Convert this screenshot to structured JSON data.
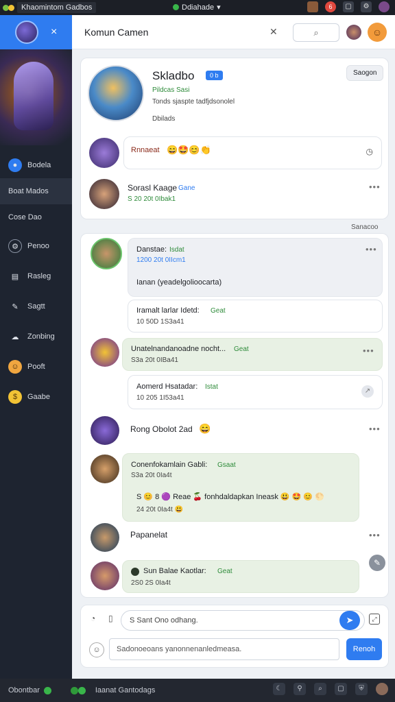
{
  "topbar": {
    "app_title": "Khaomintom Gadbos",
    "center_label": "Ddiahade",
    "badge_count": "6"
  },
  "sidebar": {
    "close_icon": "×",
    "items": [
      {
        "label": "Bodela",
        "icon": "user-circle"
      },
      {
        "label": "Boat Mados",
        "icon": ""
      },
      {
        "label": "Cose Dao",
        "icon": ""
      },
      {
        "label": "Penoo",
        "icon": "settings"
      },
      {
        "label": "Rasleg",
        "icon": "chart"
      },
      {
        "label": "Sagtt",
        "icon": "thumb"
      },
      {
        "label": "Zonbing",
        "icon": "cloud"
      },
      {
        "label": "Pooft",
        "icon": "person"
      },
      {
        "label": "Gaabe",
        "icon": "coin"
      }
    ]
  },
  "header": {
    "title": "Komun Camen",
    "search_icon": "⌕"
  },
  "profile": {
    "name": "Skladbo",
    "badge": "0 b",
    "line1": "Pildcas Sasi",
    "line2": "Tonds sjaspte tadfjdsonolel",
    "line3": "Dbilads",
    "action_button": "Saogon"
  },
  "reaction_row": {
    "text": "Rnnaeat",
    "emoji": "😄🤩😊👏"
  },
  "posts": [
    {
      "name": "Sorasl Kaage",
      "tag": "Gane",
      "meta": "S 20 20t 0Ibak1"
    },
    {
      "name": "Danstae:",
      "tag": "Isdat",
      "meta": "1200 20t 0IIcm1",
      "body": "Ianan (yeadelgolioocarta)"
    },
    {
      "name": "Iramalt larlar Idetd:",
      "tag": "Geat",
      "meta": "10 50D 1S3a41"
    },
    {
      "name": "Unatelnandanoadne nocht...",
      "tag": "Geat",
      "meta": "S3a 20t 0IBa41"
    },
    {
      "name": "Aomerd Hsatadar:",
      "tag": "Istat",
      "meta": "10 205 1I53a41"
    },
    {
      "name": "Rong Obolot 2ad",
      "emoji": "😄"
    },
    {
      "name": "Conenfokamlain Gabli:",
      "tag": "Gsaat",
      "meta": "S3a 20t 0Ia4t",
      "body": "S 😊 8 🟣 Reae 🍒 fonhdaldapkan Ineask 😃 🤩 😊 🌕",
      "sub2": "24 20t 0Ia4t 😃"
    },
    {
      "name": "Papanelat",
      "meta": ""
    },
    {
      "name": "Sun Balae Kaotlar:",
      "tag": "Geat",
      "meta": "2S0 2S 0Ia4t"
    }
  ],
  "section_label": "Sanacoo",
  "composer": {
    "placeholder": "S Sant Ono odhang.",
    "text": "Sadonoeoans yanonnenanledmeasa.",
    "send_label": "Renoh"
  },
  "bottombar": {
    "left_label": "Obontbar",
    "center_label": "Iaanat Gantodags"
  },
  "colors": {
    "accent": "#2f7cf0",
    "green": "#2e8b3a"
  }
}
